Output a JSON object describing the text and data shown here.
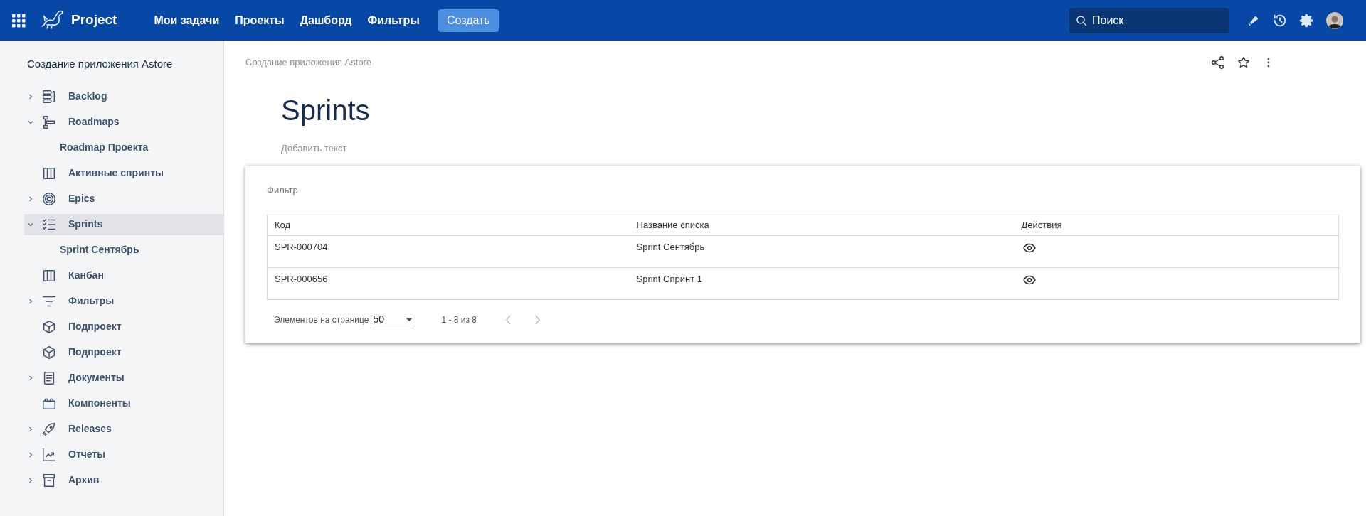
{
  "header": {
    "brand": "Project",
    "nav": [
      {
        "label": "Мои задачи"
      },
      {
        "label": "Проекты"
      },
      {
        "label": "Дашборд"
      },
      {
        "label": "Фильтры"
      }
    ],
    "create_button": "Создать",
    "search": {
      "placeholder": "Поиск"
    }
  },
  "sidebar": {
    "title": "Создание приложения Astore",
    "items": [
      {
        "label": "Backlog",
        "expandable": true,
        "expanded": false,
        "selected": false
      },
      {
        "label": "Roadmaps",
        "expandable": true,
        "expanded": true,
        "selected": false,
        "children": [
          {
            "label": "Roadmap Проекта",
            "selected": false
          }
        ]
      },
      {
        "label": "Активные спринты",
        "expandable": false,
        "selected": false
      },
      {
        "label": "Epics",
        "expandable": true,
        "expanded": false,
        "selected": false
      },
      {
        "label": "Sprints",
        "expandable": true,
        "expanded": true,
        "selected": true,
        "children": [
          {
            "label": "Sprint Сентябрь",
            "selected": false
          }
        ]
      },
      {
        "label": "Канбан",
        "expandable": false,
        "selected": false
      },
      {
        "label": "Фильтры",
        "expandable": true,
        "expanded": false,
        "selected": false
      },
      {
        "label": "Подпроект",
        "expandable": false,
        "selected": false
      },
      {
        "label": "Подпроект",
        "expandable": false,
        "selected": false
      },
      {
        "label": "Документы",
        "expandable": true,
        "expanded": false,
        "selected": false
      },
      {
        "label": "Компоненты",
        "expandable": false,
        "selected": false
      },
      {
        "label": "Releases",
        "expandable": true,
        "expanded": false,
        "selected": false
      },
      {
        "label": "Отчеты",
        "expandable": true,
        "expanded": false,
        "selected": false
      },
      {
        "label": "Архив",
        "expandable": true,
        "expanded": false,
        "selected": false
      }
    ]
  },
  "page": {
    "breadcrumb": "Создание приложения Astore",
    "title": "Sprints",
    "description_placeholder": "Добавить текст"
  },
  "card": {
    "filter_label": "Фильтр",
    "table": {
      "columns": [
        "Код",
        "Название списка",
        "Действия"
      ],
      "rows": [
        {
          "code": "SPR-000704",
          "name": "Sprint Сентябрь"
        },
        {
          "code": "SPR-000656",
          "name": "Sprint Спринт 1"
        }
      ]
    },
    "pagination": {
      "page_size_label": "Элементов на странице",
      "page_size": "50",
      "range": "1 - 8 из 8"
    }
  }
}
